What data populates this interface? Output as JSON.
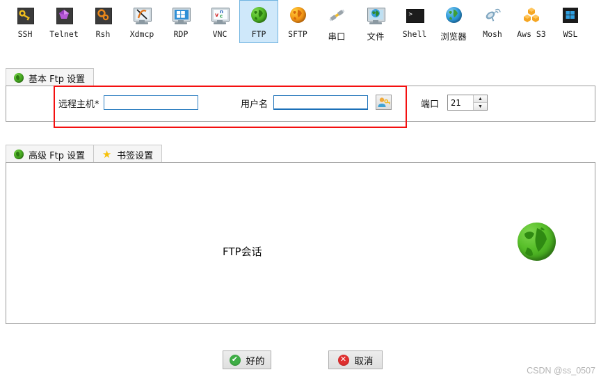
{
  "toolbar": {
    "items": [
      {
        "label": "SSH",
        "icon": "key-icon",
        "selected": false,
        "cjk": false
      },
      {
        "label": "Telnet",
        "icon": "gem-icon",
        "selected": false,
        "cjk": false
      },
      {
        "label": "Rsh",
        "icon": "gears-icon",
        "selected": false,
        "cjk": false
      },
      {
        "label": "Xdmcp",
        "icon": "monitor-x-icon",
        "selected": false,
        "cjk": false
      },
      {
        "label": "RDP",
        "icon": "monitor-windows-icon",
        "selected": false,
        "cjk": false
      },
      {
        "label": "VNC",
        "icon": "monitor-vnc-icon",
        "selected": false,
        "cjk": false
      },
      {
        "label": "FTP",
        "icon": "globe-green-icon",
        "selected": true,
        "cjk": false
      },
      {
        "label": "SFTP",
        "icon": "globe-orange-icon",
        "selected": false,
        "cjk": false
      },
      {
        "label": "串口",
        "icon": "serial-plug-icon",
        "selected": false,
        "cjk": true
      },
      {
        "label": "文件",
        "icon": "monitor-globe-icon",
        "selected": false,
        "cjk": true
      },
      {
        "label": "Shell",
        "icon": "terminal-icon",
        "selected": false,
        "cjk": false
      },
      {
        "label": "浏览器",
        "icon": "globe-blue-icon",
        "selected": false,
        "cjk": true
      },
      {
        "label": "Mosh",
        "icon": "satellite-icon",
        "selected": false,
        "cjk": false
      },
      {
        "label": "Aws S3",
        "icon": "aws-cubes-icon",
        "selected": false,
        "cjk": false
      },
      {
        "label": "WSL",
        "icon": "windows-icon",
        "selected": false,
        "cjk": false
      }
    ]
  },
  "basic_tab": {
    "label": "基本 Ftp 设置",
    "icon": "globe-green-icon"
  },
  "basic_panel": {
    "host": {
      "label": "远程主机*",
      "value": "",
      "placeholder": ""
    },
    "user": {
      "label": "用户名",
      "value": "",
      "placeholder": ""
    },
    "user_picker_icon": "user-key-icon",
    "port": {
      "label": "端口",
      "value": "21",
      "up_glyph": "▲",
      "down_glyph": "▼"
    }
  },
  "secondary_tabs": [
    {
      "label": "高级 Ftp 设置",
      "icon": "globe-green-icon",
      "selected": false
    },
    {
      "label": "书签设置",
      "icon": "star-icon",
      "selected": false
    }
  ],
  "session_panel": {
    "title": "FTP会话",
    "icon": "globe-green-large-icon"
  },
  "footer": {
    "ok": {
      "label": "好的",
      "glyph": "✔",
      "color": "#3fae46"
    },
    "cancel": {
      "label": "取消",
      "glyph": "✕",
      "color": "#e02f2f"
    }
  },
  "watermark": "CSDN @ss_0507",
  "highlight": {
    "color": "#f40f0f"
  }
}
